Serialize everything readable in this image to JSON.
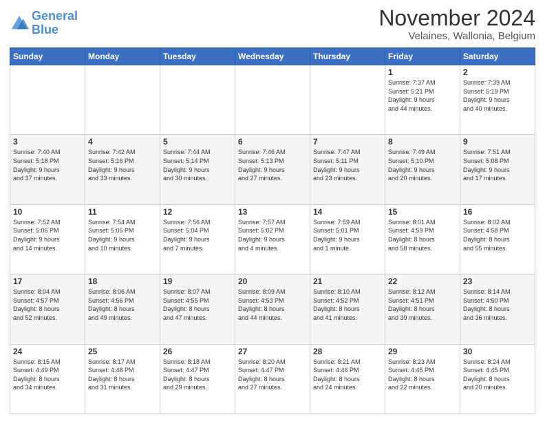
{
  "logo": {
    "line1": "General",
    "line2": "Blue"
  },
  "title": "November 2024",
  "location": "Velaines, Wallonia, Belgium",
  "days_of_week": [
    "Sunday",
    "Monday",
    "Tuesday",
    "Wednesday",
    "Thursday",
    "Friday",
    "Saturday"
  ],
  "weeks": [
    [
      {
        "day": "",
        "info": ""
      },
      {
        "day": "",
        "info": ""
      },
      {
        "day": "",
        "info": ""
      },
      {
        "day": "",
        "info": ""
      },
      {
        "day": "",
        "info": ""
      },
      {
        "day": "1",
        "info": "Sunrise: 7:37 AM\nSunset: 5:21 PM\nDaylight: 9 hours\nand 44 minutes."
      },
      {
        "day": "2",
        "info": "Sunrise: 7:39 AM\nSunset: 5:19 PM\nDaylight: 9 hours\nand 40 minutes."
      }
    ],
    [
      {
        "day": "3",
        "info": "Sunrise: 7:40 AM\nSunset: 5:18 PM\nDaylight: 9 hours\nand 37 minutes."
      },
      {
        "day": "4",
        "info": "Sunrise: 7:42 AM\nSunset: 5:16 PM\nDaylight: 9 hours\nand 33 minutes."
      },
      {
        "day": "5",
        "info": "Sunrise: 7:44 AM\nSunset: 5:14 PM\nDaylight: 9 hours\nand 30 minutes."
      },
      {
        "day": "6",
        "info": "Sunrise: 7:46 AM\nSunset: 5:13 PM\nDaylight: 9 hours\nand 27 minutes."
      },
      {
        "day": "7",
        "info": "Sunrise: 7:47 AM\nSunset: 5:11 PM\nDaylight: 9 hours\nand 23 minutes."
      },
      {
        "day": "8",
        "info": "Sunrise: 7:49 AM\nSunset: 5:10 PM\nDaylight: 9 hours\nand 20 minutes."
      },
      {
        "day": "9",
        "info": "Sunrise: 7:51 AM\nSunset: 5:08 PM\nDaylight: 9 hours\nand 17 minutes."
      }
    ],
    [
      {
        "day": "10",
        "info": "Sunrise: 7:52 AM\nSunset: 5:06 PM\nDaylight: 9 hours\nand 14 minutes."
      },
      {
        "day": "11",
        "info": "Sunrise: 7:54 AM\nSunset: 5:05 PM\nDaylight: 9 hours\nand 10 minutes."
      },
      {
        "day": "12",
        "info": "Sunrise: 7:56 AM\nSunset: 5:04 PM\nDaylight: 9 hours\nand 7 minutes."
      },
      {
        "day": "13",
        "info": "Sunrise: 7:57 AM\nSunset: 5:02 PM\nDaylight: 9 hours\nand 4 minutes."
      },
      {
        "day": "14",
        "info": "Sunrise: 7:59 AM\nSunset: 5:01 PM\nDaylight: 9 hours\nand 1 minute."
      },
      {
        "day": "15",
        "info": "Sunrise: 8:01 AM\nSunset: 4:59 PM\nDaylight: 8 hours\nand 58 minutes."
      },
      {
        "day": "16",
        "info": "Sunrise: 8:02 AM\nSunset: 4:58 PM\nDaylight: 8 hours\nand 55 minutes."
      }
    ],
    [
      {
        "day": "17",
        "info": "Sunrise: 8:04 AM\nSunset: 4:57 PM\nDaylight: 8 hours\nand 52 minutes."
      },
      {
        "day": "18",
        "info": "Sunrise: 8:06 AM\nSunset: 4:56 PM\nDaylight: 8 hours\nand 49 minutes."
      },
      {
        "day": "19",
        "info": "Sunrise: 8:07 AM\nSunset: 4:55 PM\nDaylight: 8 hours\nand 47 minutes."
      },
      {
        "day": "20",
        "info": "Sunrise: 8:09 AM\nSunset: 4:53 PM\nDaylight: 8 hours\nand 44 minutes."
      },
      {
        "day": "21",
        "info": "Sunrise: 8:10 AM\nSunset: 4:52 PM\nDaylight: 8 hours\nand 41 minutes."
      },
      {
        "day": "22",
        "info": "Sunrise: 8:12 AM\nSunset: 4:51 PM\nDaylight: 8 hours\nand 39 minutes."
      },
      {
        "day": "23",
        "info": "Sunrise: 8:14 AM\nSunset: 4:50 PM\nDaylight: 8 hours\nand 36 minutes."
      }
    ],
    [
      {
        "day": "24",
        "info": "Sunrise: 8:15 AM\nSunset: 4:49 PM\nDaylight: 8 hours\nand 34 minutes."
      },
      {
        "day": "25",
        "info": "Sunrise: 8:17 AM\nSunset: 4:48 PM\nDaylight: 8 hours\nand 31 minutes."
      },
      {
        "day": "26",
        "info": "Sunrise: 8:18 AM\nSunset: 4:47 PM\nDaylight: 8 hours\nand 29 minutes."
      },
      {
        "day": "27",
        "info": "Sunrise: 8:20 AM\nSunset: 4:47 PM\nDaylight: 8 hours\nand 27 minutes."
      },
      {
        "day": "28",
        "info": "Sunrise: 8:21 AM\nSunset: 4:46 PM\nDaylight: 8 hours\nand 24 minutes."
      },
      {
        "day": "29",
        "info": "Sunrise: 8:23 AM\nSunset: 4:45 PM\nDaylight: 8 hours\nand 22 minutes."
      },
      {
        "day": "30",
        "info": "Sunrise: 8:24 AM\nSunset: 4:45 PM\nDaylight: 8 hours\nand 20 minutes."
      }
    ]
  ]
}
